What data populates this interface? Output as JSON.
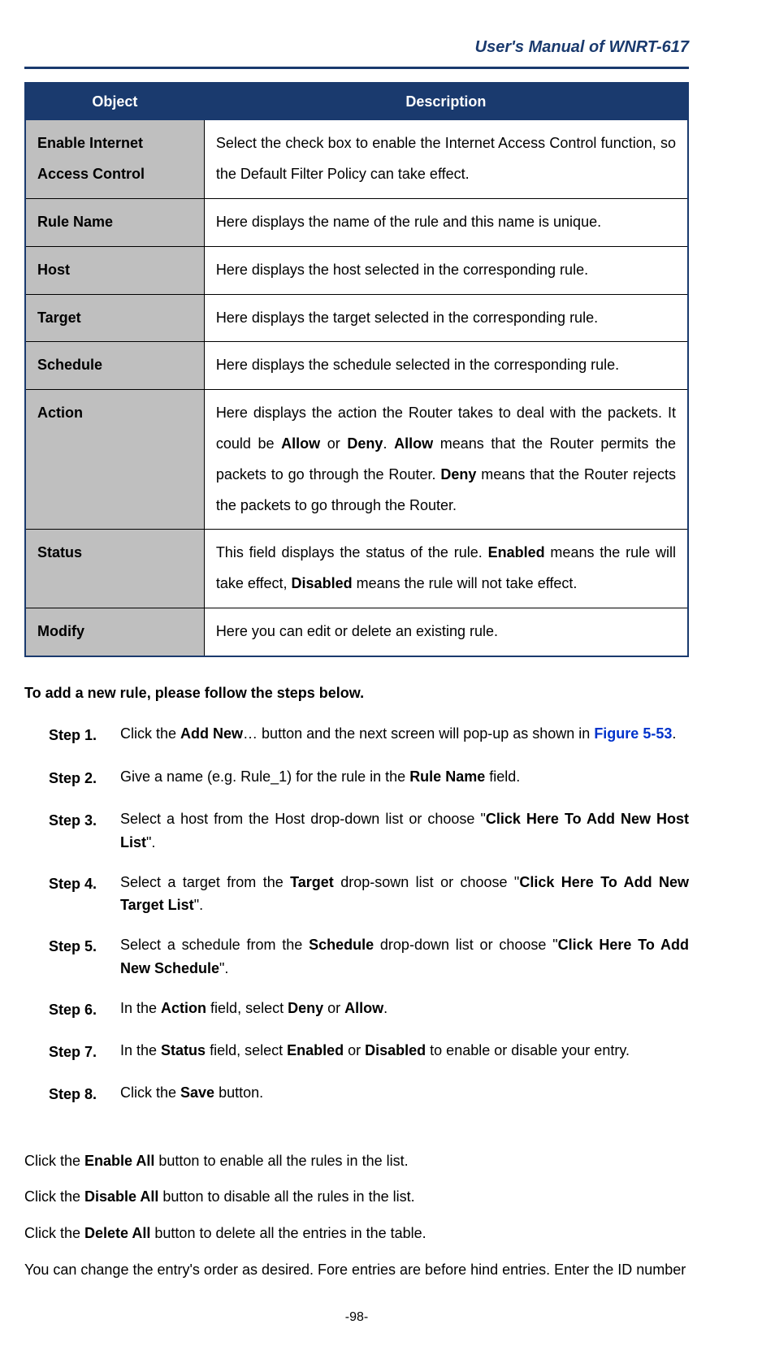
{
  "header": {
    "title": "User's Manual of WNRT-617"
  },
  "table": {
    "col_object": "Object",
    "col_description": "Description",
    "rows": [
      {
        "object": "Enable Internet Access Control",
        "desc_parts": [
          "Select the check box to enable the Internet Access Control function, so the Default Filter Policy can take effect."
        ]
      },
      {
        "object": "Rule Name",
        "desc_parts": [
          "Here displays the name of the rule and this name is unique."
        ]
      },
      {
        "object": "Host",
        "desc_parts": [
          "Here displays the host selected in the corresponding rule."
        ]
      },
      {
        "object": "Target",
        "desc_parts": [
          "Here displays the target selected in the corresponding rule."
        ]
      },
      {
        "object": "Schedule",
        "desc_parts": [
          "Here displays the schedule selected in the corresponding rule."
        ]
      },
      {
        "object": "Action",
        "desc_parts": [
          "Here displays the action the Router takes to deal with the packets. It could be ",
          {
            "bold": true,
            "text": "Allow"
          },
          " or ",
          {
            "bold": true,
            "text": "Deny"
          },
          ". ",
          {
            "bold": true,
            "text": "Allow"
          },
          " means that the Router permits the packets to go through the Router. ",
          {
            "bold": true,
            "text": "Deny"
          },
          " means that the Router rejects the packets to go through the Router."
        ]
      },
      {
        "object": "Status",
        "desc_parts": [
          "This field displays the status of the rule. ",
          {
            "bold": true,
            "text": "Enabled"
          },
          " means the rule will take effect, ",
          {
            "bold": true,
            "text": "Disabled"
          },
          " means the rule will not take effect."
        ]
      },
      {
        "object": "Modify",
        "desc_parts": [
          "Here you can edit or delete an existing rule."
        ]
      }
    ]
  },
  "steps_heading": "To add a new rule, please follow the steps below.",
  "steps": [
    {
      "label": "Step 1.",
      "parts": [
        "Click the ",
        {
          "bold": true,
          "text": "Add New"
        },
        "… button and the next screen will pop-up as shown in ",
        {
          "link": true,
          "text": "Figure 5-53"
        },
        "."
      ]
    },
    {
      "label": "Step 2.",
      "parts": [
        "Give a name (e.g. Rule_1) for the rule in the ",
        {
          "bold": true,
          "text": "Rule Name"
        },
        " field."
      ]
    },
    {
      "label": "Step 3.",
      "parts": [
        "Select a host from the Host drop-down list or choose \"",
        {
          "bold": true,
          "text": "Click Here To Add New Host List"
        },
        "\"."
      ]
    },
    {
      "label": "Step 4.",
      "parts": [
        "Select a target from the ",
        {
          "bold": true,
          "text": "Target"
        },
        " drop-sown list or choose \"",
        {
          "bold": true,
          "text": "Click Here To Add New Target List"
        },
        "\"."
      ]
    },
    {
      "label": "Step 5.",
      "parts": [
        "Select a schedule from the ",
        {
          "bold": true,
          "text": "Schedule"
        },
        " drop-down list or choose \"",
        {
          "bold": true,
          "text": "Click Here To Add New Schedule"
        },
        "\"."
      ]
    },
    {
      "label": "Step 6.",
      "parts": [
        "In the ",
        {
          "bold": true,
          "text": "Action"
        },
        " field, select ",
        {
          "bold": true,
          "text": "Deny"
        },
        " or ",
        {
          "bold": true,
          "text": "Allow"
        },
        "."
      ]
    },
    {
      "label": "Step 7.",
      "parts": [
        "In the ",
        {
          "bold": true,
          "text": "Status"
        },
        " field, select ",
        {
          "bold": true,
          "text": "Enabled"
        },
        " or ",
        {
          "bold": true,
          "text": "Disabled"
        },
        " to enable or disable your entry."
      ]
    },
    {
      "label": "Step 8.",
      "parts": [
        "Click the ",
        {
          "bold": true,
          "text": "Save"
        },
        " button."
      ]
    }
  ],
  "paragraphs": [
    {
      "parts": [
        "Click the ",
        {
          "bold": true,
          "text": "Enable All"
        },
        " button to enable all the rules in the list."
      ]
    },
    {
      "parts": [
        "Click the ",
        {
          "bold": true,
          "text": "Disable All"
        },
        " button to disable all the rules in the list."
      ]
    },
    {
      "parts": [
        "Click the ",
        {
          "bold": true,
          "text": "Delete All"
        },
        " button to delete all the entries in the table."
      ]
    },
    {
      "parts": [
        "You can change the entry's order as desired. Fore entries are before hind entries. Enter the ID number"
      ]
    }
  ],
  "page_number": "-98-"
}
